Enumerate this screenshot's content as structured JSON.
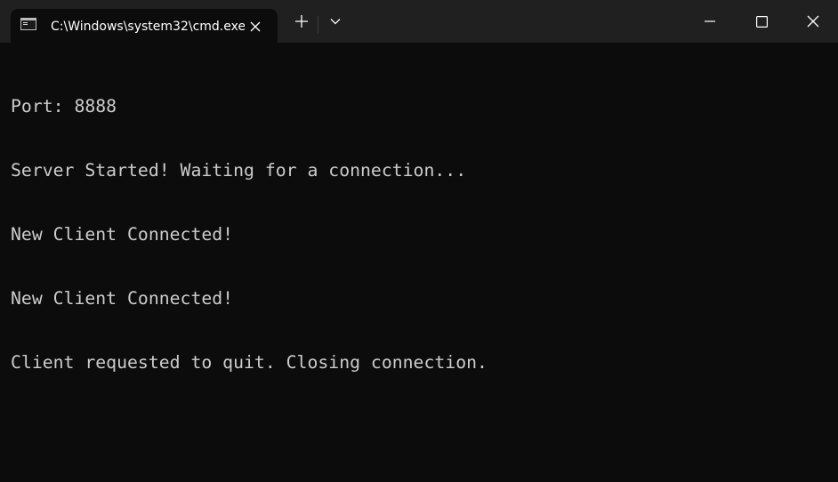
{
  "window": {
    "tab_title": "C:\\Windows\\system32\\cmd.exe",
    "tab_icon": "cmd-icon"
  },
  "titlebar": {
    "buttons": {
      "close_tab": "close-icon",
      "new_tab": "plus-icon",
      "dropdown": "chevron-down-icon",
      "minimize": "minimize-icon",
      "maximize": "maximize-icon",
      "close_window": "close-icon"
    }
  },
  "console": {
    "lines": [
      "Port: 8888",
      "Server Started! Waiting for a connection...",
      "New Client Connected!",
      "New Client Connected!",
      "Client requested to quit. Closing connection."
    ]
  },
  "colors": {
    "titlebar_bg": "#202020",
    "console_bg": "#0c0c0c",
    "console_text": "#cccccc"
  }
}
